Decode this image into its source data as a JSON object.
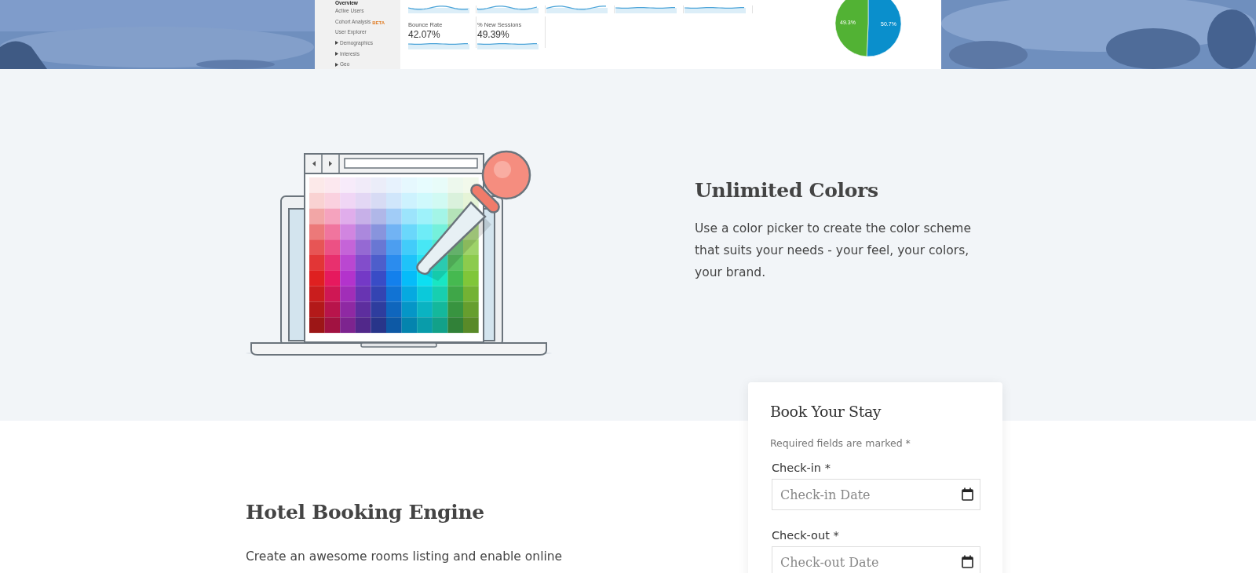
{
  "hero_screenshot": {
    "sidebar": {
      "items": [
        {
          "label": "Overview",
          "selected": true,
          "expandable": false
        },
        {
          "label": "Active Users",
          "selected": false,
          "expandable": false
        },
        {
          "label": "Cohort Analysis",
          "badge": "BETA",
          "selected": false,
          "expandable": false
        },
        {
          "label": "User Explorer",
          "selected": false,
          "expandable": false
        },
        {
          "label": "Demographics",
          "selected": false,
          "expandable": true
        },
        {
          "label": "Interests",
          "selected": false,
          "expandable": true
        },
        {
          "label": "Geo",
          "selected": false,
          "expandable": true
        }
      ]
    },
    "metrics": [
      {
        "label": "Bounce Rate",
        "value": "42.07%"
      },
      {
        "label": "% New Sessions",
        "value": "49.39%"
      }
    ],
    "chart_data": {
      "type": "pie",
      "values": [
        50.7,
        49.3
      ],
      "colors": [
        "#0a8fcc",
        "#52b234"
      ],
      "value_labels": [
        "50.7%",
        "49.3%"
      ]
    }
  },
  "features": [
    {
      "title": "Unlimited Colors",
      "text": "Use a color picker to create the color scheme that suits your needs - your feel, your colors, your brand."
    },
    {
      "title": "Hotel Booking Engine",
      "text": "Create an awesome rooms listing and enable online"
    }
  ],
  "booking_form": {
    "title": "Book Your Stay",
    "note": "Required fields are marked *",
    "fields": [
      {
        "label": "Check-in *",
        "placeholder": "Check-in Date"
      },
      {
        "label": "Check-out *",
        "placeholder": "Check-out Date"
      }
    ]
  }
}
